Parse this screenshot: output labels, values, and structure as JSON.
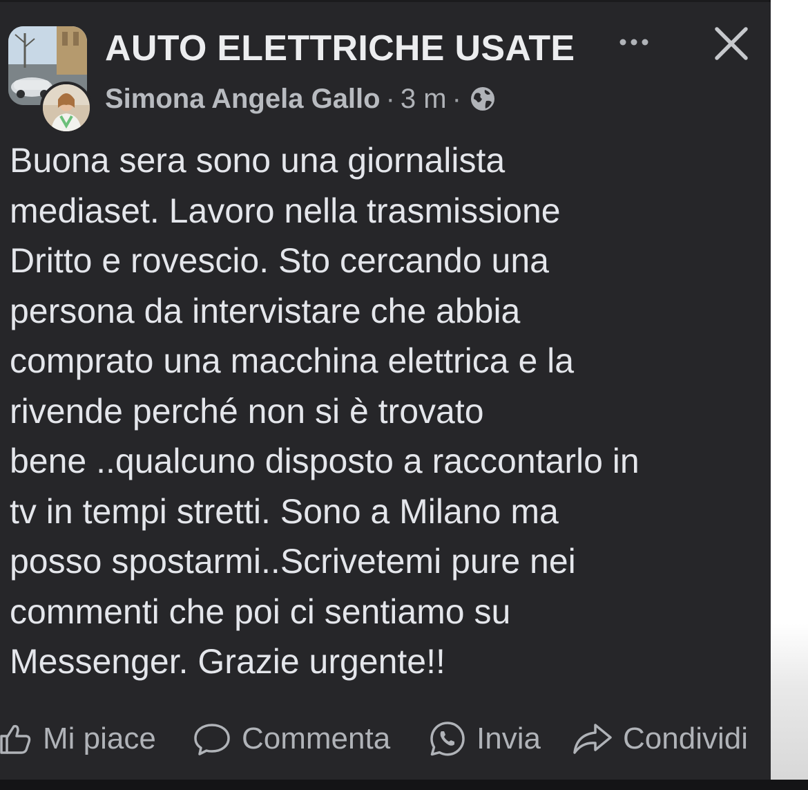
{
  "header": {
    "group_name": "AUTO ELETTRICHE USATE",
    "author": "Simona Angela Gallo",
    "separator": "·",
    "time": "3 m",
    "privacy_icon": "globe-icon",
    "more_icon": "more-options-icon",
    "close_icon": "close-icon"
  },
  "post": {
    "lines": [
      "Buona sera sono una giornalista",
      "mediaset. Lavoro nella trasmissione",
      "Dritto e rovescio. Sto cercando una",
      "persona da intervistare che abbia",
      "comprato una macchina elettrica e la",
      "rivende perché non si è trovato",
      "bene ..qualcuno disposto a raccontarlo in",
      "tv in tempi stretti. Sono a Milano ma",
      "posso spostarmi..Scrivetemi pure nei",
      "commenti che poi ci sentiamo su",
      "Messenger. Grazie urgente!!"
    ]
  },
  "actions": {
    "like": "Mi piace",
    "comment": "Commenta",
    "send": "Invia",
    "share": "Condividi"
  },
  "colors": {
    "background": "#262629",
    "text": "#e4e6eb",
    "secondary_text": "#b0b3b8"
  }
}
